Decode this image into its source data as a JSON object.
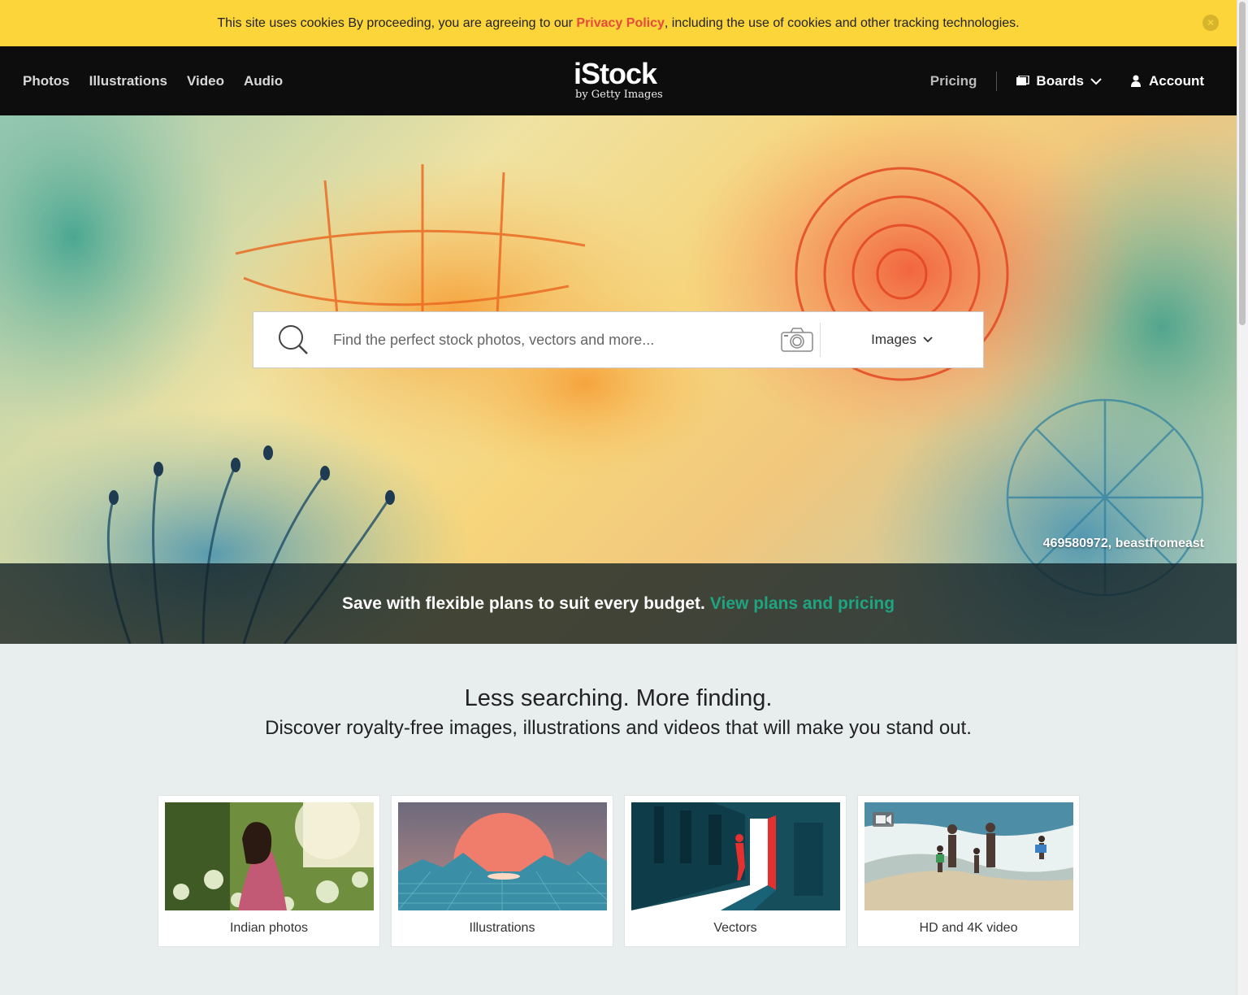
{
  "cookie": {
    "text_before": "This site uses cookies By proceeding, you are agreeing to our ",
    "link": "Privacy Policy",
    "text_after": ", including the use of cookies and other tracking technologies.",
    "close": "×"
  },
  "nav": {
    "items": [
      "Photos",
      "Illustrations",
      "Video",
      "Audio"
    ],
    "logo": "iStock",
    "logo_sub": "by Getty Images",
    "pricing": "Pricing",
    "boards": "Boards",
    "account": "Account"
  },
  "search": {
    "placeholder": "Find the perfect stock photos, vectors and more...",
    "type": "Images"
  },
  "hero": {
    "credit": "469580972, beastfromeast",
    "promo_text": "Save with flexible plans to suit every budget.",
    "promo_link": "View plans and pricing"
  },
  "intro": {
    "heading": "Less searching. More finding.",
    "subheading": "Discover royalty-free images, illustrations and videos that will make you stand out."
  },
  "cards": [
    {
      "label": "Indian photos"
    },
    {
      "label": "Illustrations"
    },
    {
      "label": "Vectors"
    },
    {
      "label": "HD and 4K video"
    }
  ],
  "colors": {
    "cookie_bg": "#fcd53a",
    "link_red": "#e8493a",
    "nav_bg": "#0d0d0d",
    "promo_green": "#1fa481",
    "page_bg": "#e8eded"
  }
}
